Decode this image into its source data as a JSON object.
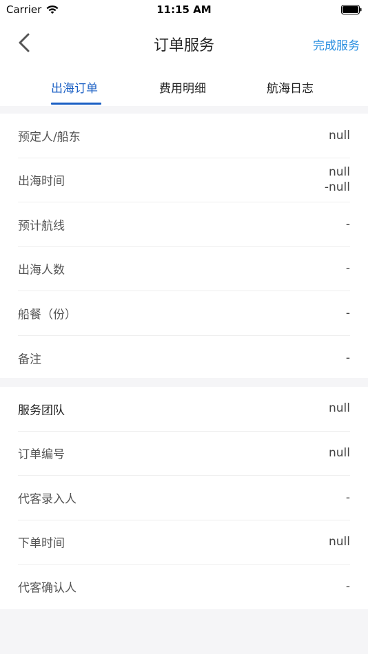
{
  "status_bar": {
    "carrier": "Carrier",
    "time": "11:15 AM"
  },
  "nav": {
    "title": "订单服务",
    "action": "完成服务"
  },
  "tabs": [
    {
      "label": "出海订单",
      "active": true
    },
    {
      "label": "费用明细",
      "active": false
    },
    {
      "label": "航海日志",
      "active": false
    }
  ],
  "section1": {
    "rows": [
      {
        "label": "预定人/船东",
        "value": "null"
      },
      {
        "label": "出海时间",
        "value_line1": "null",
        "value_line2": "-null"
      },
      {
        "label": "预计航线",
        "value": "-"
      },
      {
        "label": "出海人数",
        "value": "-"
      },
      {
        "label": "船餐（份）",
        "value": "-"
      },
      {
        "label": "备注",
        "value": "-"
      }
    ]
  },
  "section2": {
    "rows": [
      {
        "label": "服务团队",
        "value": "null"
      },
      {
        "label": "订单编号",
        "value": "null"
      },
      {
        "label": "代客录入人",
        "value": "-"
      },
      {
        "label": "下单时间",
        "value": "null"
      },
      {
        "label": "代客确认人",
        "value": "-"
      }
    ]
  },
  "colors": {
    "accent": "#1a5fc4",
    "action": "#2a8fe0",
    "background": "#f5f5f7"
  }
}
